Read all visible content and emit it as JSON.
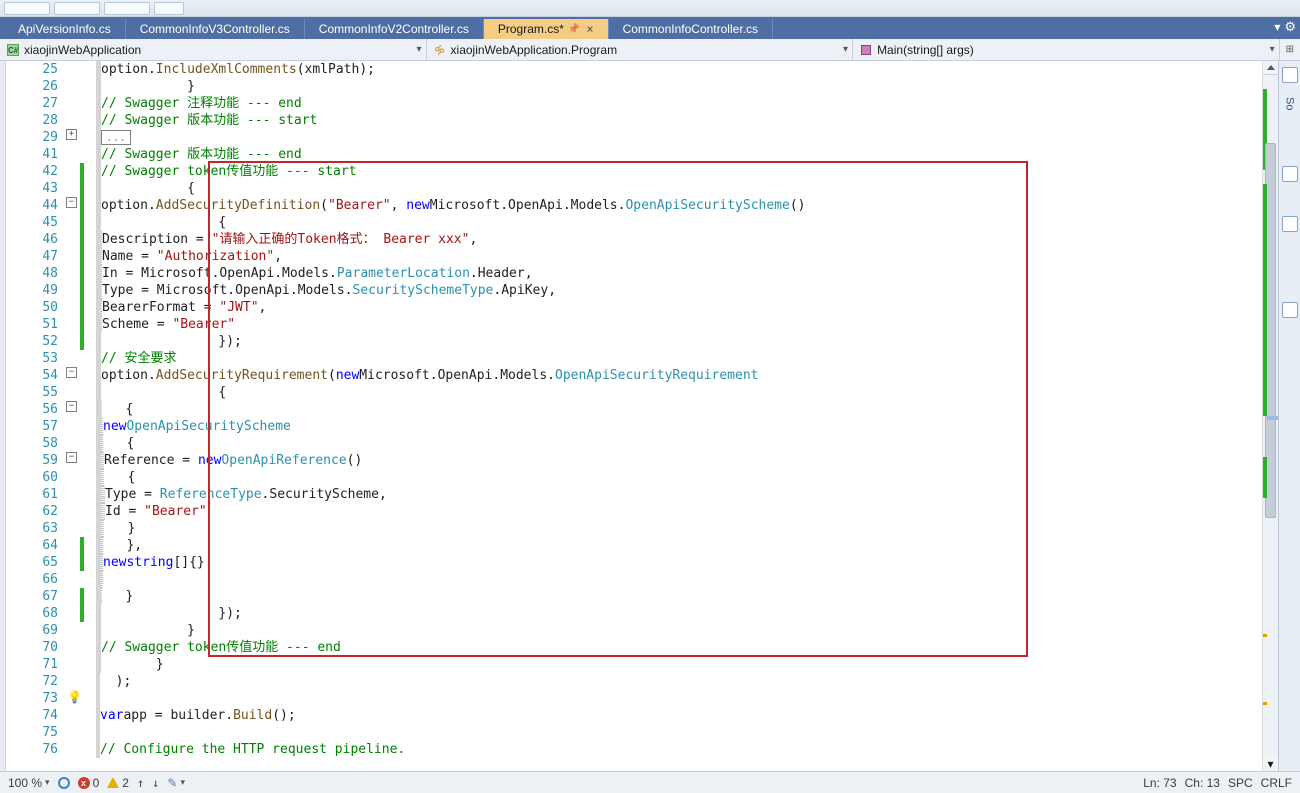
{
  "tabs": [
    {
      "label": "ApiVersionInfo.cs",
      "active": false
    },
    {
      "label": "CommonInfoV3Controller.cs",
      "active": false
    },
    {
      "label": "CommonInfoV2Controller.cs",
      "active": false
    },
    {
      "label": "Program.cs*",
      "active": true,
      "dirty": true
    },
    {
      "label": "CommonInfoController.cs",
      "active": false
    }
  ],
  "nav": {
    "project": "xiaojinWebApplication",
    "class": "xiaojinWebApplication.Program",
    "member": "Main(string[] args)"
  },
  "code": {
    "lines": [
      25,
      26,
      27,
      28,
      29,
      41,
      42,
      43,
      44,
      45,
      46,
      47,
      48,
      49,
      50,
      51,
      52,
      53,
      54,
      55,
      56,
      57,
      58,
      59,
      60,
      61,
      62,
      63,
      64,
      65,
      66,
      67,
      68,
      69,
      70,
      71,
      72,
      73,
      74,
      75,
      76
    ],
    "current_line": 73,
    "collapsed_marker": "...",
    "fold": {
      "29": "+",
      "44": "-",
      "54": "-",
      "56": "-",
      "59": "-"
    },
    "green_track": [
      42,
      43,
      44,
      45,
      46,
      47,
      48,
      49,
      50,
      51,
      52,
      64,
      65,
      67,
      68
    ],
    "highlight": {
      "start": 42,
      "end": 70
    },
    "text": {
      "c27": "// Swagger 注释功能 --- end",
      "c28": "// Swagger 版本功能 --- start",
      "c41": "// Swagger 版本功能 --- end",
      "c42": "// Swagger token传值功能 --- start",
      "c53": "// 安全要求",
      "c70": "// Swagger token传值功能 --- end",
      "c76": "// Configure the HTTP request pipeline.",
      "s_bearer": "\"Bearer\"",
      "s_desc": "\"请输入正确的Token格式： Bearer xxx\"",
      "s_auth": "\"Authorization\"",
      "s_jwt": "\"JWT\"",
      "option": "option",
      "dot": ".",
      "IncludeXmlComments": "IncludeXmlComments",
      "xmlPath": "xmlPath",
      "AddSecurityDefinition": "AddSecurityDefinition",
      "AddSecurityRequirement": "AddSecurityRequirement",
      "new": "new",
      "var": "var",
      "string": "string",
      "Microsoft": "Microsoft",
      "OpenApi": "OpenApi",
      "Models": "Models",
      "OpenApiSecurityScheme": "OpenApiSecurityScheme",
      "OpenApiSecurityRequirement": "OpenApiSecurityRequirement",
      "OpenApiReference": "OpenApiReference",
      "ParameterLocation": "ParameterLocation",
      "Header": "Header",
      "SecuritySchemeType": "SecuritySchemeType",
      "ApiKey": "ApiKey",
      "ReferenceType": "ReferenceType",
      "SecurityScheme": "SecurityScheme",
      "Description": "Description",
      "Name": "Name",
      "In": "In",
      "Type": "Type",
      "BearerFormat": "BearerFormat",
      "Scheme": "Scheme",
      "Reference": "Reference",
      "Id": "Id",
      "app": "app",
      "builder": "builder",
      "Build": "Build"
    }
  },
  "status": {
    "zoom": "100 %",
    "errors": "0",
    "warnings": "2",
    "ln": "Ln: 73",
    "ch": "Ch: 13",
    "spc": "SPC",
    "crlf": "CRLF"
  },
  "side_label": "So"
}
